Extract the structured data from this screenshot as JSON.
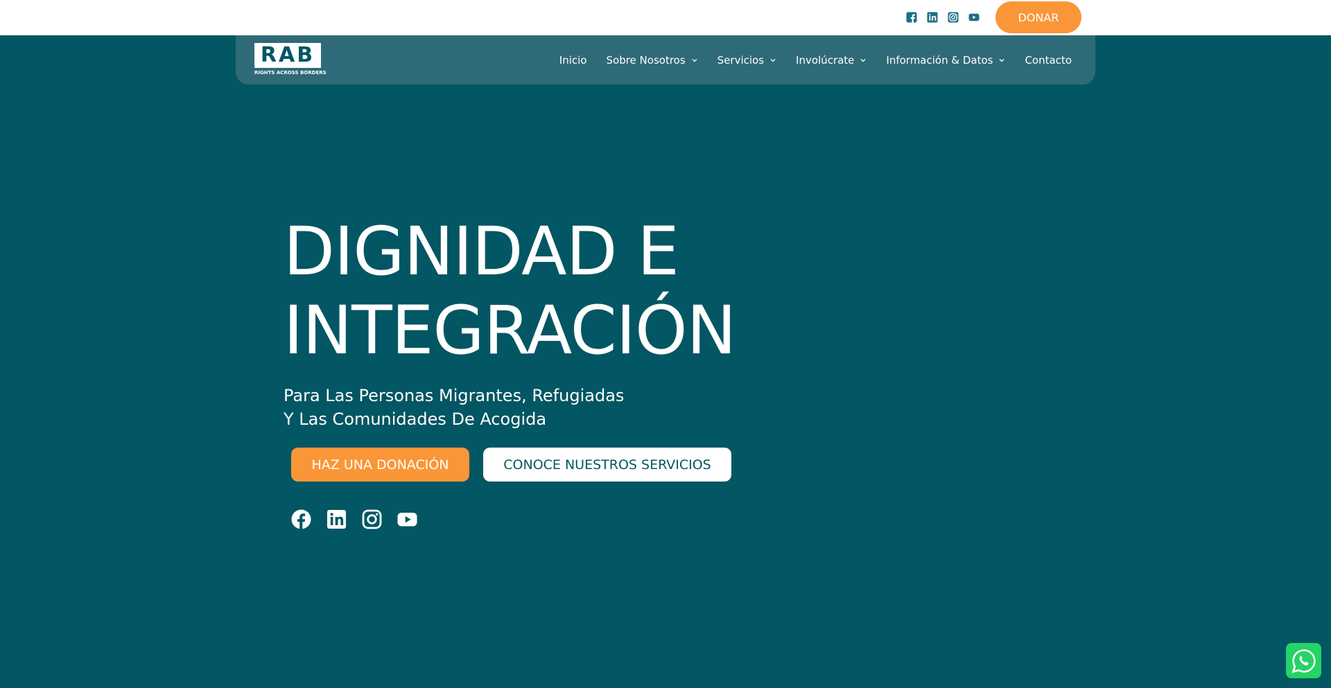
{
  "topbar": {
    "social": [
      {
        "icon": "facebook-icon"
      },
      {
        "icon": "linkedin-icon"
      },
      {
        "icon": "instagram-icon"
      },
      {
        "icon": "youtube-icon"
      }
    ],
    "donate_label": "DONAR"
  },
  "header": {
    "logo": {
      "letters": "RAB",
      "tagline": "RIGHTS ACROSS BORDERS"
    },
    "menu": [
      {
        "label": "Inicio",
        "has_dropdown": false
      },
      {
        "label": "Sobre Nosotros",
        "has_dropdown": true
      },
      {
        "label": "Servicios",
        "has_dropdown": true
      },
      {
        "label": "Involúcrate",
        "has_dropdown": true
      },
      {
        "label": "Información & Datos",
        "has_dropdown": true
      },
      {
        "label": "Contacto",
        "has_dropdown": false
      }
    ]
  },
  "hero": {
    "title_line1": "DIGNIDAD E",
    "title_line2": "INTEGRACIÓN",
    "subtitle_line1": "Para Las Personas Migrantes, Refugiadas",
    "subtitle_line2": "Y Las Comunidades De Acogida",
    "cta_donate": "HAZ UNA DONACIÓN",
    "cta_services": "CONOCE NUESTROS SERVICIOS",
    "social": [
      {
        "icon": "facebook-icon"
      },
      {
        "icon": "linkedin-icon"
      },
      {
        "icon": "instagram-icon"
      },
      {
        "icon": "youtube-icon"
      }
    ]
  },
  "floating": {
    "whatsapp": {
      "icon": "whatsapp-icon"
    }
  },
  "colors": {
    "background": "#035663",
    "nav_background": "#2f6a79",
    "accent": "#fa9637",
    "whatsapp": "#25d366"
  }
}
